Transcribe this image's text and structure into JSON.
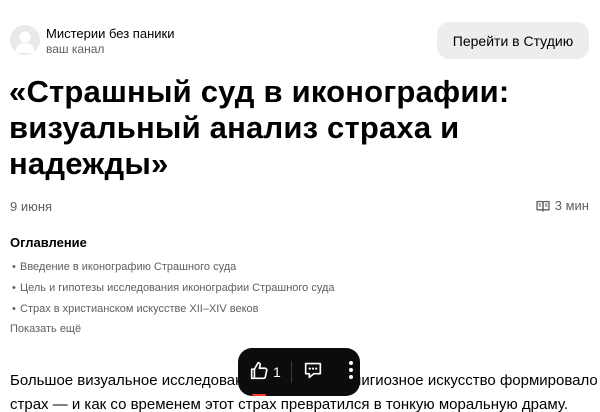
{
  "header": {
    "channel_name": "Мистерии без паники",
    "channel_subtitle": "ваш канал",
    "studio_button_label": "Перейти в Студию"
  },
  "article": {
    "title": "«Страшный суд в иконографии: визуальный анализ страха и надежды»",
    "date": "9 июня",
    "read_time": "3 мин",
    "body_lines": [
      "Большое визуальное исследование о том, как религиозное искусство формировало",
      "страх — и как со временем этот страх превратился в тонкую моральную драму."
    ]
  },
  "toc": {
    "title": "Оглавление",
    "bullet": "•",
    "items": [
      "Введение в иконографию Страшного суда",
      "Цель и гипотезы исследования иконографии Страшного суда",
      "Страх в христианском искусстве XII–XIV веков"
    ],
    "show_more_label": "Показать ещё"
  },
  "action_bar": {
    "like_count": "1",
    "icons": [
      "thumbs-up-icon",
      "comment-icon",
      "more-vertical-icon"
    ],
    "accent_color": "#ff3b1f"
  },
  "colors": {
    "background": "#ffffff",
    "text": "#000000",
    "muted_text": "#5f5f63",
    "button_bg": "#ededef",
    "action_bar_bg": "#0c0c0e"
  }
}
